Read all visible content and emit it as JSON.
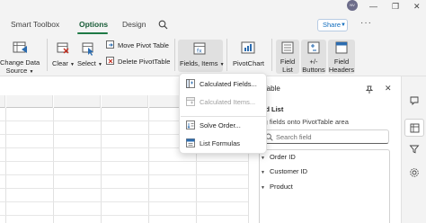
{
  "app": {
    "avatar_initials": "NV"
  },
  "tabs": [
    {
      "label": "Smart Toolbox",
      "active": false
    },
    {
      "label": "Options",
      "active": true
    },
    {
      "label": "Design",
      "active": false
    }
  ],
  "share": {
    "label": "Share"
  },
  "ribbon": {
    "change_data_source": {
      "line1": "Change Data",
      "line2": "Source"
    },
    "clear": {
      "label": "Clear"
    },
    "select": {
      "label": "Select"
    },
    "move_pivot_table": {
      "label": "Move Pivot Table"
    },
    "delete_pivot_table": {
      "label": "Delete PivotTable"
    },
    "fields_items": {
      "label": "Fields, Items"
    },
    "pivot_chart": {
      "label": "PivotChart"
    },
    "field_list": {
      "line1": "Field",
      "line2": "List"
    },
    "plus_minus_buttons": {
      "line1": "+/-",
      "line2": "Buttons"
    },
    "field_headers": {
      "line1": "Field",
      "line2": "Headers"
    }
  },
  "dropdown_menu": {
    "items": [
      {
        "label": "Calculated Fields...",
        "enabled": true
      },
      {
        "label": "Calculated Items...",
        "enabled": false
      },
      {
        "label": "Solve Order...",
        "enabled": true
      },
      {
        "label": "List Formulas",
        "enabled": true
      }
    ]
  },
  "pivot_pane": {
    "title_visible": "otTable",
    "field_list_visible": "ield List",
    "subtitle_visible": "rag fields onto PivotTable area",
    "search_placeholder": "Search field",
    "fields": [
      "Order ID",
      "Customer ID",
      "Product"
    ]
  },
  "colors": {
    "accent_green": "#1f7a45",
    "ribbon_bg": "#f3f3f3",
    "share_blue": "#0f6cbd",
    "icon_blue": "#2b6cb0"
  }
}
